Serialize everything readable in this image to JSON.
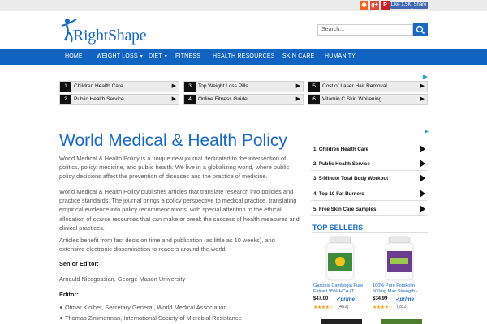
{
  "social": [
    {
      "icon": "rss-icon",
      "glyph": "◉",
      "color": "#f26522"
    },
    {
      "icon": "google-plus-icon",
      "glyph": "g+",
      "color": "#dd4b39"
    },
    {
      "icon": "pinterest-icon",
      "glyph": "P",
      "color": "#cb2027"
    },
    {
      "icon": "twitter-icon",
      "glyph": "t",
      "color": "#1da1f2"
    }
  ],
  "facebook": {
    "like": "Like 1.5K",
    "share": "Share"
  },
  "logo": {
    "text": "RightShape"
  },
  "search": {
    "placeholder": "Search..."
  },
  "nav": {
    "items": [
      {
        "label": "HOME"
      },
      {
        "label": "WEIGHT LOSS",
        "dropdown": true
      },
      {
        "label": "DIET",
        "dropdown": true
      },
      {
        "label": "FITNESS"
      },
      {
        "label": "HEALTH RESOURCES"
      },
      {
        "label": "SKIN CARE"
      },
      {
        "label": "HUMANITY"
      }
    ]
  },
  "top_ads": [
    {
      "num": "1",
      "label": "Children Health Care"
    },
    {
      "num": "2",
      "label": "Public Health Service"
    },
    {
      "num": "3",
      "label": "Top Weight Loss Pills"
    },
    {
      "num": "4",
      "label": "Online Fitness Guide"
    },
    {
      "num": "5",
      "label": "Cost of Laser Hair Removal"
    },
    {
      "num": "6",
      "label": "Vitamin C Skin Whitening"
    }
  ],
  "article": {
    "title": "World Medical & Health Policy",
    "p1": "World Medical & Health Policy is a unique new journal dedicated to the intersection of politics, policy, medicine, and public health. We live in a globalizing world, where public policy decisions affect the prevention of diseases and the practice of medicine.",
    "p2": "World Medical & Health Policy publishes articles that translate research into policies and practice standards. The journal brings a policy perspective to medical practice, translating empirical evidence into policy recommendations, with special attention to the ethical allocation of scarce resources that can make or break the success of health measures and clinical practices.",
    "p3": "Articles benefit from fast decision time and publication (as little as 10 weeks), and extensive electronic dissemination to readers around the world.",
    "senior_editor_label": "Senior Editor:",
    "senior_editor": "Arnauld Nicogossian, George Mason University",
    "editor_label": "Editor:",
    "editors": [
      "Otmar Kloiber, Secretary General, World Medical Association",
      "Thomas Zimmerman, International Society of Microbial Resistance"
    ]
  },
  "side_ads": [
    {
      "label": "1. Children Health Care"
    },
    {
      "label": "2. Public Health Service"
    },
    {
      "label": "3. 5-Minute Total Body Workout"
    },
    {
      "label": "4. Top 10 Fat Burners"
    },
    {
      "label": "5. Free Skin Care Samples"
    }
  ],
  "top_sellers": {
    "title": "TOP SELLERS",
    "products": [
      {
        "name": "Garcinia Cambogia Pure Extract 95% HCA (T...",
        "price": "$47.00",
        "prime": "✓prime",
        "stars": "★★★★☆",
        "reviews": "(462)",
        "color": "#3d8b3d"
      },
      {
        "name": "100% Pure Forskolin 500mg Max Strength -...",
        "price": "$34.99",
        "prime": "✓prime",
        "stars": "★★★★☆",
        "reviews": "(282)",
        "color": "#6a3d8f"
      }
    ]
  }
}
